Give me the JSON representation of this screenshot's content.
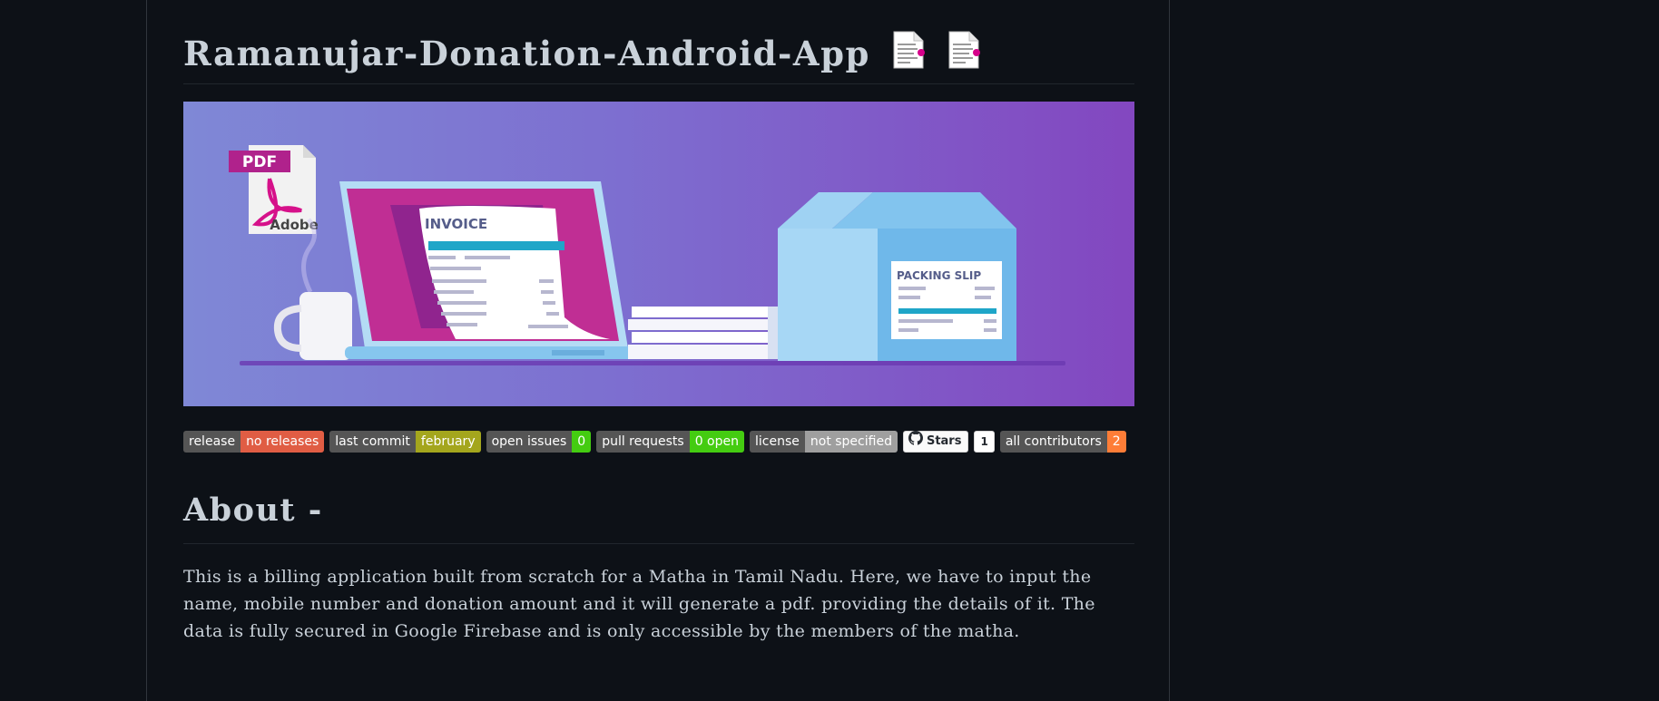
{
  "title": "Ramanujar-Donation-Android-App",
  "title_icons": [
    "document-icon",
    "document-icon"
  ],
  "banner": {
    "pdf_label": "PDF",
    "adobe_label": "Adobe",
    "invoice_label": "INVOICE",
    "packing_label": "PACKING SLIP"
  },
  "badges": [
    {
      "key": "release",
      "value": "no releases",
      "color": "#e05d44"
    },
    {
      "key": "last commit",
      "value": "february",
      "color": "#a4a61d"
    },
    {
      "key": "open issues",
      "value": "0",
      "color": "#44cc11"
    },
    {
      "key": "pull requests",
      "value": "0 open",
      "color": "#44cc11"
    },
    {
      "key": "license",
      "value": "not specified",
      "color": "#9f9f9f"
    }
  ],
  "stars": {
    "label": "Stars",
    "count": "1"
  },
  "contributors": {
    "key": "all contributors",
    "value": "2",
    "color": "#fe7d37"
  },
  "about": {
    "heading": "About -",
    "text": "This is a billing application built from scratch for a Matha in Tamil Nadu. Here, we have to input the name, mobile number and donation amount and it will generate a pdf. providing the details of it. The data is fully secured in Google Firebase and is only accessible by the members of the matha."
  }
}
